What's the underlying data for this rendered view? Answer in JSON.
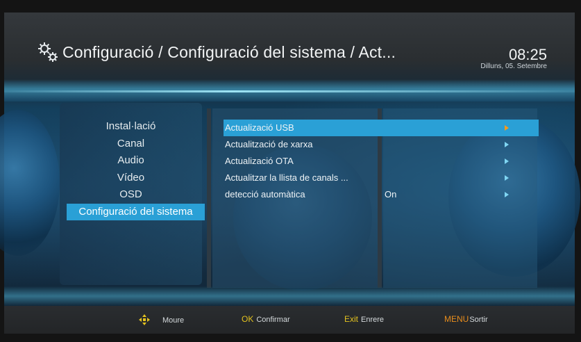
{
  "header": {
    "title": "Configuració / Configuració del sistema / Act...",
    "time": "08:25",
    "date": "Dilluns, 05. Setembre"
  },
  "left_menu": [
    {
      "label": "Instal·lació",
      "active": false
    },
    {
      "label": "Canal",
      "active": false
    },
    {
      "label": "Audio",
      "active": false
    },
    {
      "label": "Vídeo",
      "active": false
    },
    {
      "label": "OSD",
      "active": false
    },
    {
      "label": "Configuració del sistema",
      "active": true
    }
  ],
  "sub_menu": [
    {
      "label": "Actualizació USB",
      "value": "",
      "active": true
    },
    {
      "label": "Actualització de xarxa",
      "value": "",
      "active": false
    },
    {
      "label": "Actualizació OTA",
      "value": "",
      "active": false
    },
    {
      "label": "Actualitzar la llista de canals ...",
      "value": "",
      "active": false
    },
    {
      "label": "detecció automàtica",
      "value": "On",
      "active": false
    }
  ],
  "footer": {
    "move_label": "Moure",
    "ok_key": "OK",
    "ok_label": "Confirmar",
    "exit_key": "Exit",
    "exit_label": "Enrere",
    "menu_key": "MENU",
    "menu_label": "Sortir"
  },
  "colors": {
    "accent": "#2aa0d6",
    "arrow_active": "#f39a1c",
    "ok_key": "#e3c21f",
    "exit_key": "#e3c21f",
    "menu_key": "#e88d1d"
  },
  "icons": {
    "title": "gears-icon",
    "move": "move-arrows-icon",
    "submenu_arrow": "arrow-right-icon"
  }
}
